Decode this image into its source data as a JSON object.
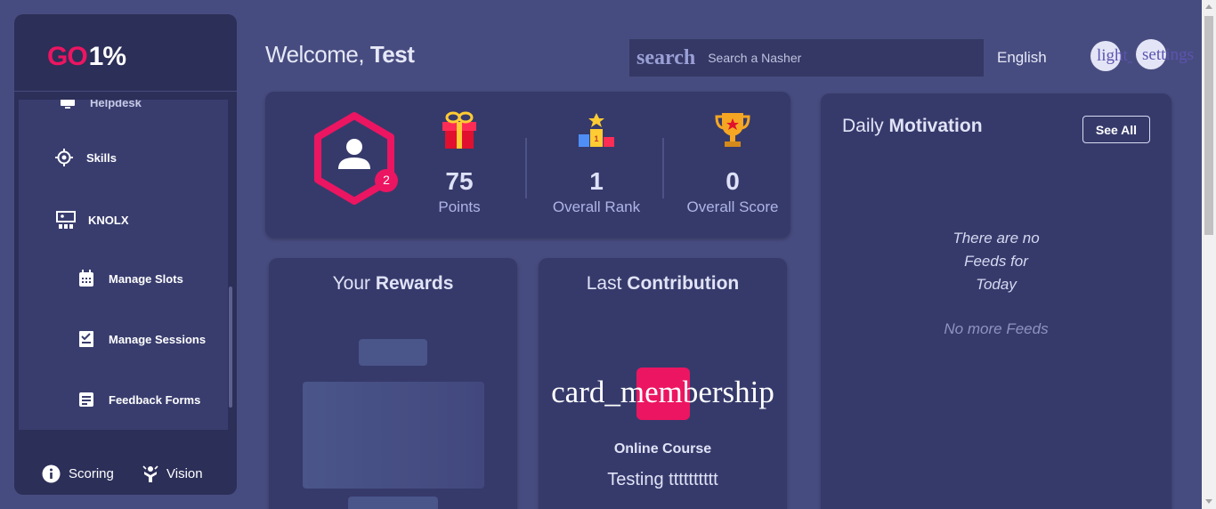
{
  "logo": {
    "go": "GO",
    "rest": "1%"
  },
  "sidebar": {
    "items": [
      {
        "label": "Helpdesk",
        "icon": "monitor-icon"
      },
      {
        "label": "Skills",
        "icon": "skills-icon"
      },
      {
        "label": "KNOLX",
        "icon": "presentation-icon"
      },
      {
        "label": "Manage Slots",
        "icon": "calendar-icon"
      },
      {
        "label": "Manage Sessions",
        "icon": "checklist-icon"
      },
      {
        "label": "Feedback Forms",
        "icon": "form-icon"
      }
    ],
    "bottom": [
      {
        "label": "Scoring",
        "icon": "info-icon"
      },
      {
        "label": "Vision",
        "icon": "vision-icon"
      }
    ]
  },
  "header": {
    "welcome_prefix": "Welcome,",
    "welcome_name": "Test",
    "search_word": "search",
    "search_placeholder": "Search a Nasher",
    "language": "English",
    "theme_button": "light_mode",
    "settings_button": "settings"
  },
  "profile": {
    "badge": "2"
  },
  "stats": [
    {
      "value": "75",
      "label": "Points",
      "icon": "gift-icon"
    },
    {
      "value": "1",
      "label": "Overall Rank",
      "icon": "podium-icon"
    },
    {
      "value": "0",
      "label": "Overall Score",
      "icon": "trophy-icon"
    }
  ],
  "rewards": {
    "title_light": "Your",
    "title_bold": "Rewards"
  },
  "contribution": {
    "title_light": "Last",
    "title_bold": "Contribution",
    "icon_text": "card_membership",
    "type": "Online Course",
    "name": "Testing tttttttttt"
  },
  "motivation": {
    "title_light": "Daily",
    "title_bold": "Motivation",
    "see_all": "See All",
    "empty_line1": "There are no",
    "empty_line2": "Feeds for",
    "empty_line3": "Today",
    "no_more": "No more Feeds"
  },
  "colors": {
    "accent": "#ec1561",
    "background": "#474c80",
    "card": "#363a6b",
    "sidebar": "#2c2f58"
  }
}
